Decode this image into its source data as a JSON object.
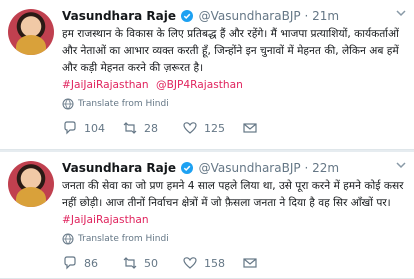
{
  "tweets": [
    {
      "name": "Vasundhara Raje",
      "handle": "@VasundharaBJP",
      "separator": "·",
      "time": "21m",
      "text": "हम राजस्थान के विकास के लिए प्रतिबद्ध हैं और रहेंगे। मैं भाजपा प्रत्याशियों, कार्यकर्ताओं और नेताओं का आभार व्यक्त करती हूँ, जिन्होंने इन चुनावों में मेहनत की, लेकिन अब हमें और कड़ी मेहनत करने की ज़रूरत है।",
      "hashtags": [
        "#JaiJaiRajasthan",
        "@BJP4Rajasthan"
      ],
      "translate": "Translate from Hindi",
      "replies": "104",
      "retweets": "28",
      "likes": "125"
    },
    {
      "name": "Vasundhara Raje",
      "handle": "@VasundharaBJP",
      "separator": "·",
      "time": "22m",
      "text": "जनता की सेवा का जो प्रण हमने 4 साल पहले लिया था, उसे पूरा करने में हमने कोई कसर नहीं छोड़ी। आज तीनों निर्वाचन क्षेत्रों में जो फ़ैसला जनता ने दिया है वह सिर आँखों पर।",
      "hashtags": [
        "#JaiJaiRajasthan"
      ],
      "translate": "Translate from Hindi",
      "replies": "86",
      "retweets": "50",
      "likes": "158"
    }
  ],
  "colors": {
    "link": "#e0245e",
    "verified": "#1da1f2",
    "meta": "#657786"
  }
}
